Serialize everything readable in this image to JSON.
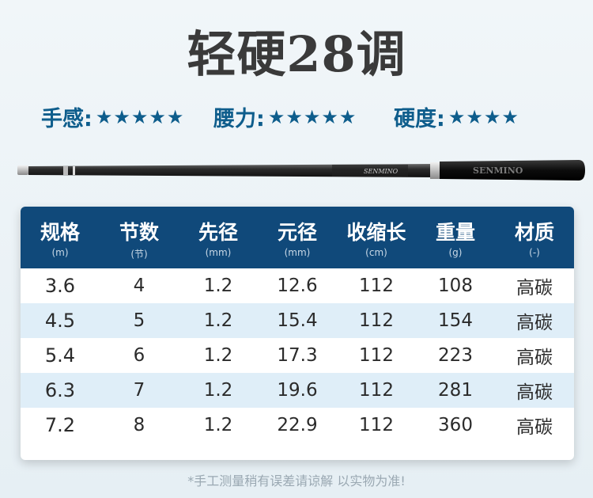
{
  "title": "轻硬28调",
  "ratings": [
    {
      "label": "手感:",
      "stars": "★★★★★",
      "count": 5
    },
    {
      "label": "腰力:",
      "stars": "★★★★★",
      "count": 5
    },
    {
      "label": "硬度:",
      "stars": "★★★★",
      "count": 4
    }
  ],
  "rod": {
    "brand_blank": "SENMINO",
    "brand_handle": "SENMINO",
    "colors": {
      "blank": "#2a2a2a",
      "grip": "#111111",
      "band": "#c9c9c9"
    }
  },
  "table": {
    "headers": [
      {
        "name": "规格",
        "unit": "(m)"
      },
      {
        "name": "节数",
        "unit": "(节)"
      },
      {
        "name": "先径",
        "unit": "(mm)"
      },
      {
        "name": "元径",
        "unit": "(mm)"
      },
      {
        "name": "收缩长",
        "unit": "(cm)"
      },
      {
        "name": "重量",
        "unit": "(g)"
      },
      {
        "name": "材质",
        "unit": "(-)"
      }
    ],
    "rows": [
      [
        "3.6",
        "4",
        "1.2",
        "12.6",
        "112",
        "108",
        "高碳"
      ],
      [
        "4.5",
        "5",
        "1.2",
        "15.4",
        "112",
        "154",
        "高碳"
      ],
      [
        "5.4",
        "6",
        "1.2",
        "17.3",
        "112",
        "223",
        "高碳"
      ],
      [
        "6.3",
        "7",
        "1.2",
        "19.6",
        "112",
        "281",
        "高碳"
      ],
      [
        "7.2",
        "8",
        "1.2",
        "22.9",
        "112",
        "360",
        "高碳"
      ]
    ]
  },
  "footer": "*手工测量稍有误差请谅解 以实物为准!",
  "colors": {
    "header": "#10497a",
    "accent": "#0e5d8c",
    "alt_row": "#dfeef8"
  }
}
